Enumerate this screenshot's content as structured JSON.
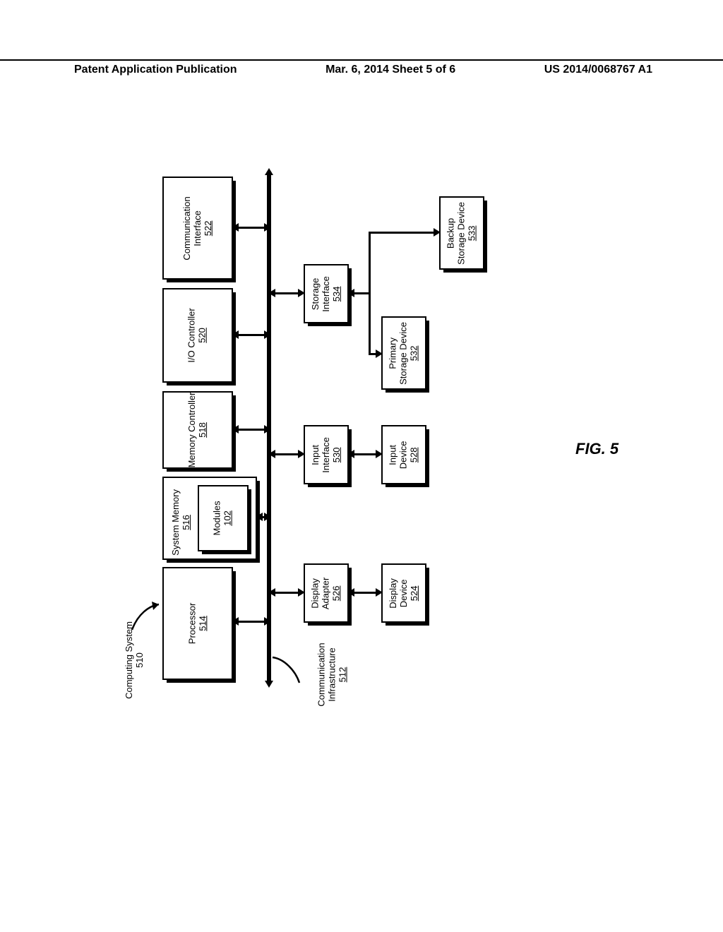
{
  "header": {
    "left": "Patent Application Publication",
    "center": "Mar. 6, 2014  Sheet 5 of 6",
    "right": "US 2014/0068767 A1"
  },
  "system_label": "Computing System",
  "system_ref": "510",
  "comm_infra_label": "Communication\nInfrastructure",
  "comm_infra_ref": "512",
  "figure_label": "FIG. 5",
  "blocks": {
    "processor": {
      "label": "Processor",
      "ref": "514"
    },
    "sysmem": {
      "label": "System Memory",
      "ref": "516"
    },
    "modules": {
      "label": "Modules",
      "ref": "102"
    },
    "memctrl": {
      "label": "Memory Controller",
      "ref": "518"
    },
    "ioctrl": {
      "label": "I/O Controller",
      "ref": "520"
    },
    "comm": {
      "label": "Communication\nInterface",
      "ref": "522"
    },
    "dispadapt": {
      "label": "Display\nAdapter",
      "ref": "526"
    },
    "dispdev": {
      "label": "Display\nDevice",
      "ref": "524"
    },
    "inputif": {
      "label": "Input\nInterface",
      "ref": "530"
    },
    "inputdev": {
      "label": "Input\nDevice",
      "ref": "528"
    },
    "storageif": {
      "label": "Storage\nInterface",
      "ref": "534"
    },
    "primstor": {
      "label": "Primary\nStorage Device",
      "ref": "532"
    },
    "backupstor": {
      "label": "Backup\nStorage Device",
      "ref": "533"
    }
  }
}
